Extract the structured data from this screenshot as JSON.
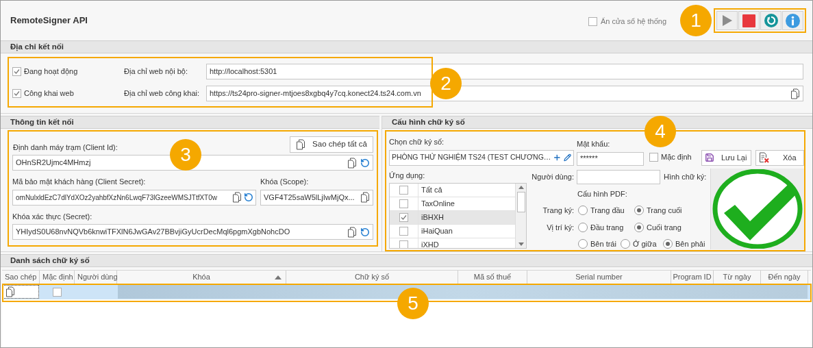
{
  "window": {
    "title": "RemoteSigner API",
    "callout": "1"
  },
  "hide_system_window": {
    "label": "Ẩn cửa sổ hệ thống",
    "checked": false
  },
  "toolbar": [
    {
      "kind": "play"
    },
    {
      "kind": "stop"
    },
    {
      "kind": "refresh"
    },
    {
      "kind": "info"
    }
  ],
  "connection": {
    "title": "Địa chỉ kết nối",
    "callout": "2",
    "rows": [
      {
        "check_label": "Đang hoạt động",
        "checked": true,
        "label": "Địa chỉ web nội bộ:",
        "value": "http://localhost:5301",
        "copy": false
      },
      {
        "check_label": "Công khai web",
        "checked": true,
        "label": "Địa chỉ web công khai:",
        "value": "https://ts24pro-signer-mtjoes8xgbq4y7cq.konect24.ts24.com.vn",
        "copy": true
      }
    ]
  },
  "client_info": {
    "title": "Thông tin kết nối",
    "callout": "3",
    "copy_all": "Sao chép tất cả",
    "client_id": {
      "label": "Định danh máy trạm (Client Id):",
      "value": "OHnSR2Ujmc4MHmzj"
    },
    "client_secret": {
      "label": "Mã bảo mật khách hàng (Client Secret):",
      "value": "omNulxldEzC7dlYdXOz2yahbfXzNn6LwqF73lGzeeWMSJTtfXT0w"
    },
    "scope": {
      "label": "Khóa (Scope):",
      "value": "VGF4T25saW5lLjIwMjQx..."
    },
    "secret": {
      "label": "Khóa xác thực (Secret):",
      "value": "YHIydS0U68nvNQVb6knwiTFXlN6JwGAv27BBvjiGyUcrDecMql6pgmXgbNohcDO"
    }
  },
  "signature_config": {
    "title": "Cấu hình chữ ký số",
    "callout": "4",
    "choose_label": "Chọn chữ ký số:",
    "choose_value": "PHÒNG THỬ NGHIỆM TS24 (TEST CHƯƠNG…",
    "password_label": "Mật khẩu:",
    "password_value": "******",
    "default": {
      "label": "Mặc định",
      "checked": false
    },
    "save": "Lưu Lại",
    "delete": "Xóa",
    "apps_label": "Ứng dụng:",
    "apps": [
      {
        "name": "Tất cả",
        "checked": false,
        "selected": false
      },
      {
        "name": "TaxOnline",
        "checked": false,
        "selected": false
      },
      {
        "name": "iBHXH",
        "checked": true,
        "selected": true
      },
      {
        "name": "iHaiQuan",
        "checked": false,
        "selected": false
      },
      {
        "name": "iXHD",
        "checked": false,
        "selected": false
      }
    ],
    "user_label": "Người dùng:",
    "image_label": "Hình chữ ký:",
    "pdf_label": "Cấu hình PDF:",
    "radio_groups": [
      {
        "label": "Trang ký:",
        "options": [
          {
            "label": "Trang đầu",
            "selected": false
          },
          {
            "label": "Trang cuối",
            "selected": true
          }
        ]
      },
      {
        "label": "Vị trí ký:",
        "options": [
          {
            "label": "Đầu trang",
            "selected": false
          },
          {
            "label": "Cuối trang",
            "selected": true
          }
        ]
      },
      {
        "options": [
          {
            "label": "Bên trái",
            "selected": false
          },
          {
            "label": "Ở giữa",
            "selected": false
          },
          {
            "label": "Bên phải",
            "selected": true
          }
        ]
      }
    ]
  },
  "signature_list": {
    "title": "Danh sách chữ ký số",
    "callout": "5",
    "columns": [
      {
        "label": "Sao chép",
        "sorted": false
      },
      {
        "label": "Mặc định",
        "sorted": false
      },
      {
        "label": "Người dùng",
        "sorted": false
      },
      {
        "label": "Khóa",
        "sorted": true
      },
      {
        "label": "Chữ ký số",
        "sorted": false
      },
      {
        "label": "Mã số thuế",
        "sorted": false
      },
      {
        "label": "Serial number",
        "sorted": false
      },
      {
        "label": "Program ID",
        "sorted": false
      },
      {
        "label": "Từ ngày",
        "sorted": false
      },
      {
        "label": "Đến ngày",
        "sorted": false
      }
    ],
    "rows": [
      {
        "default": false,
        "selected": true
      }
    ]
  }
}
